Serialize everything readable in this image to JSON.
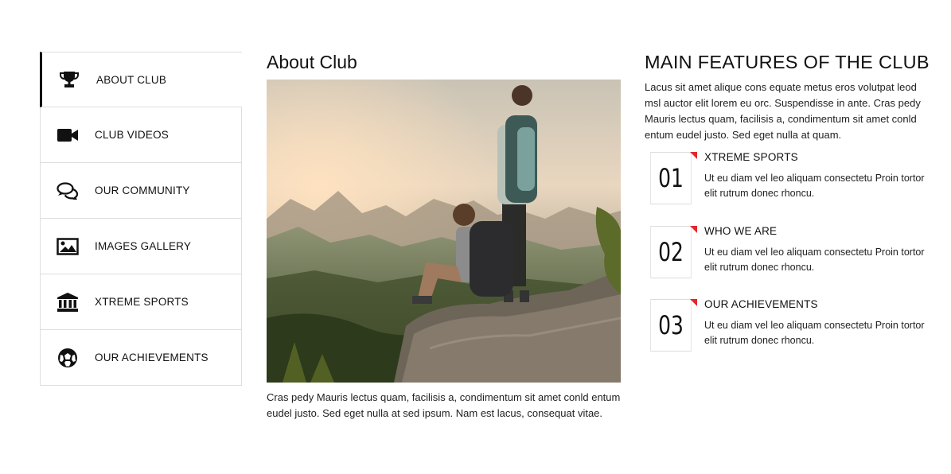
{
  "sidebar": {
    "items": [
      {
        "label": "ABOUT CLUB",
        "icon": "trophy-icon",
        "active": true
      },
      {
        "label": "CLUB VIDEOS",
        "icon": "video-camera-icon",
        "active": false
      },
      {
        "label": "OUR COMMUNITY",
        "icon": "chat-bubbles-icon",
        "active": false
      },
      {
        "label": "IMAGES GALLERY",
        "icon": "image-icon",
        "active": false
      },
      {
        "label": "XTREME SPORTS",
        "icon": "bank-icon",
        "active": false
      },
      {
        "label": "OUR ACHIEVEMENTS",
        "icon": "soccer-ball-icon",
        "active": false
      }
    ]
  },
  "about": {
    "title": "About Club",
    "image": "hikers-on-cliff-photo",
    "text": "Cras pedy Mauris lectus quam, facilisis a, condimentum sit amet conld entum eudel justo. Sed eget nulla at sed ipsum. Nam est lacus, consequat vitae."
  },
  "features": {
    "title": "MAIN FEATURES OF THE CLUB",
    "intro": "Lacus sit amet alique cons equate metus eros volutpat leod msl auctor elit lorem eu orc. Suspendisse in ante. Cras pedy Mauris lectus quam, facilisis a, condimentum sit amet conld entum eudel justo. Sed eget nulla at quam.",
    "accent_color": "#e3262b",
    "items": [
      {
        "number": "01",
        "title": "XTREME SPORTS",
        "desc": "Ut eu diam vel leo aliquam consectetu Proin tortor elit rutrum donec rhoncu."
      },
      {
        "number": "02",
        "title": "WHO WE ARE",
        "desc": "Ut eu diam vel leo aliquam consectetu Proin tortor elit rutrum donec rhoncu."
      },
      {
        "number": "03",
        "title": "OUR ACHIEVEMENTS",
        "desc": "Ut eu diam vel leo aliquam consectetu Proin tortor elit rutrum donec rhoncu."
      }
    ]
  }
}
